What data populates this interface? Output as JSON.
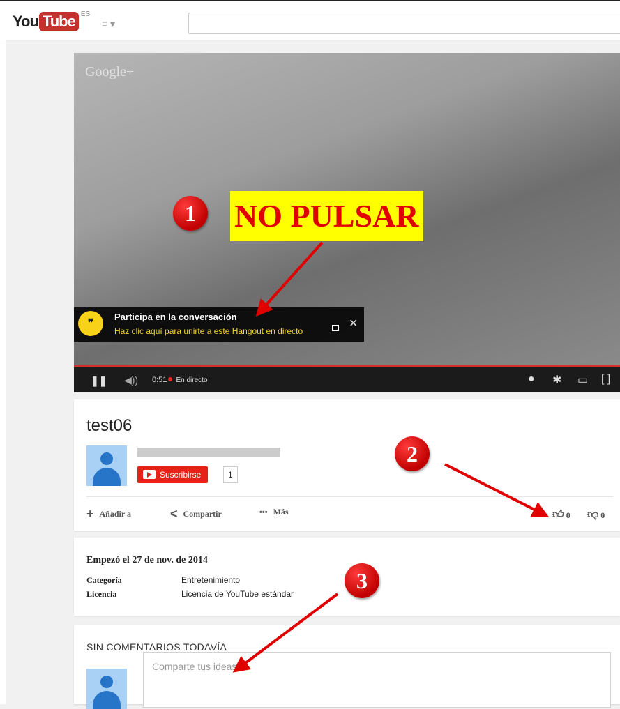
{
  "header": {
    "logo_you": "You",
    "logo_tube": "Tube",
    "locale": "ES",
    "guide_icon": "menu-icon",
    "search_placeholder": ""
  },
  "player": {
    "watermark": "Google+",
    "overlay_title": "Participa en la conversación",
    "overlay_link": "Haz clic aquí para unirte a este Hangout en directo",
    "time": "0:51",
    "live_label": "En directo",
    "progress_fraction": 1.0
  },
  "video": {
    "title": "test06",
    "subscribe_label": "Suscribirse",
    "subscriber_count": "1",
    "actions": {
      "add": "Añadir a",
      "share": "Compartir",
      "more": "Más"
    },
    "likes": "0",
    "dislikes": "0"
  },
  "details": {
    "started": "Empezó el 27 de nov. de 2014",
    "category_label": "Categoría",
    "category_value": "Entretenimiento",
    "license_label": "Licencia",
    "license_value": "Licencia de YouTube estándar"
  },
  "comments": {
    "heading": "SIN COMENTARIOS TODAVÍA",
    "placeholder": "Comparte tus ideas"
  },
  "annotations": {
    "n1": "1",
    "warning": "NO PULSAR",
    "n2": "2",
    "n3": "3",
    "color": "#e00000",
    "highlight": "#ffff00"
  }
}
